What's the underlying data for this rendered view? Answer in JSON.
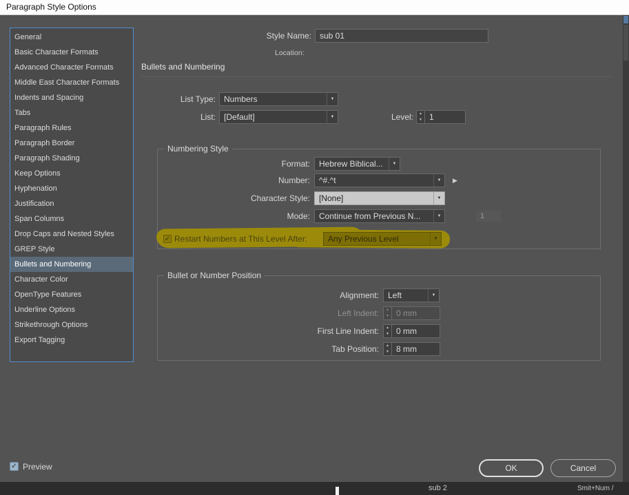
{
  "window": {
    "title": "Paragraph Style Options"
  },
  "colors": {
    "dialog_background": "#535353",
    "sidebar_border_blue": "#4f8fce",
    "selected_item_background": "#5a6a79",
    "highlight_yellow": "#9c8b0b"
  },
  "icons": {
    "dropdown_arrow": "▼",
    "spin_up": "▲",
    "spin_down": "▼",
    "check": "✓",
    "flyout": "▶"
  },
  "sidebar": {
    "selected_index": 15,
    "items": [
      "General",
      "Basic Character Formats",
      "Advanced Character Formats",
      "Middle East Character Formats",
      "Indents and Spacing",
      "Tabs",
      "Paragraph Rules",
      "Paragraph Border",
      "Paragraph Shading",
      "Keep Options",
      "Hyphenation",
      "Justification",
      "Span Columns",
      "Drop Caps and Nested Styles",
      "GREP Style",
      "Bullets and Numbering",
      "Character Color",
      "OpenType Features",
      "Underline Options",
      "Strikethrough Options",
      "Export Tagging"
    ]
  },
  "header": {
    "style_name_label": "Style Name:",
    "style_name_value": "sub 01",
    "location_label": "Location:",
    "section_title": "Bullets and Numbering"
  },
  "list_controls": {
    "list_type_label": "List Type:",
    "list_type_value": "Numbers",
    "list_label": "List:",
    "list_value": "[Default]",
    "level_label": "Level:",
    "level_value": "1"
  },
  "numbering_style": {
    "legend": "Numbering Style",
    "format_label": "Format:",
    "format_value": "Hebrew Biblical...",
    "number_label": "Number:",
    "number_value": "^#.^t",
    "character_style_label": "Character Style:",
    "character_style_value": "[None]",
    "mode_label": "Mode:",
    "mode_value": "Continue from Previous N...",
    "mode_aux_value": "1",
    "restart_label": "Restart Numbers at This Level After:",
    "restart_value": "Any Previous Level"
  },
  "position_section": {
    "legend": "Bullet or Number Position",
    "alignment_label": "Alignment:",
    "alignment_value": "Left",
    "left_indent_label": "Left Indent:",
    "left_indent_value": "0 mm",
    "first_line_indent_label": "First Line Indent:",
    "first_line_indent_value": "0 mm",
    "tab_position_label": "Tab Position:",
    "tab_position_value": "8 mm"
  },
  "footer": {
    "preview_label": "Preview",
    "ok_label": "OK",
    "cancel_label": "Cancel"
  },
  "background_strip": {
    "left_text": "sub 2",
    "right_text": "Smit+Num /"
  }
}
